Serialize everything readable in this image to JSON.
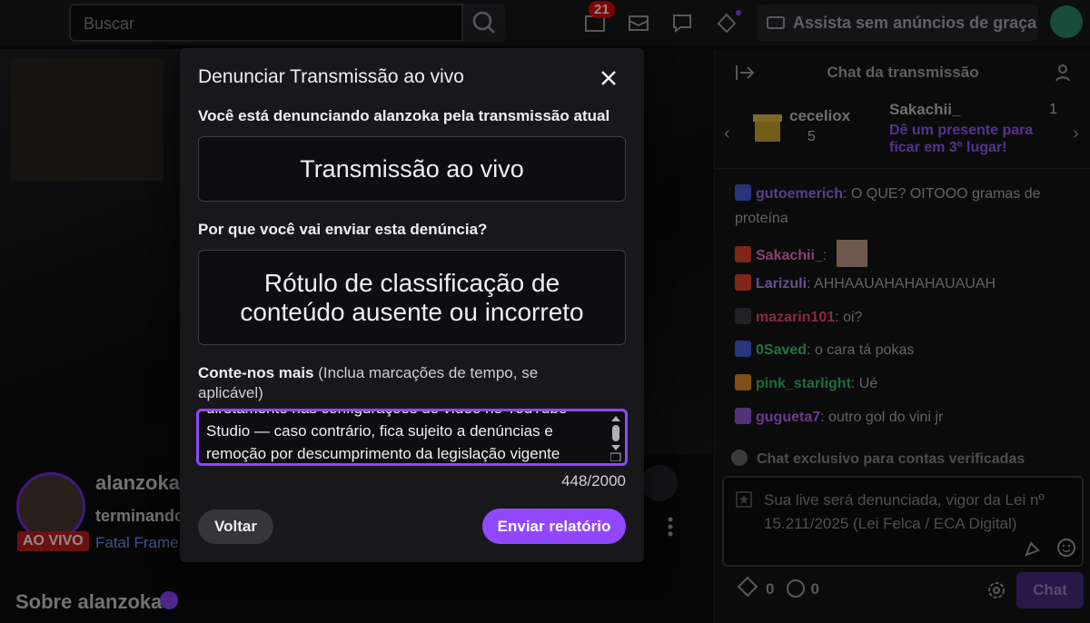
{
  "topbar": {
    "search_placeholder": "Buscar",
    "notification_count": "21",
    "promo_label": "Assista sem anúncios de graça"
  },
  "stream": {
    "streamer": "alanzoka",
    "title": "terminando",
    "game": "Fatal Frame",
    "live_label": "AO VIVO",
    "about": "Sobre alanzoka"
  },
  "chat": {
    "title": "Chat da transmissão",
    "gift_banner": {
      "first_user": "ceceliox",
      "first_count": "5",
      "second_user": "Sakachii_",
      "second_count": "1",
      "cta": "Dê um presente para ficar em 3º lugar!"
    },
    "messages": [
      {
        "user": "gutoemerich",
        "color": "#a970ff",
        "text": ": O QUE? OITOOO gramas de proteína"
      },
      {
        "user": "Sakachii_",
        "color": "#ff6fd8",
        "text": ":"
      },
      {
        "user": "Larizuli",
        "color": "#c48bff",
        "text": ": AHHAAUAHAHAHAUAUAH"
      },
      {
        "user": "mazarin101",
        "color": "#ff4d6d",
        "text": ": oi?"
      },
      {
        "user": "0Saved",
        "color": "#3ecf6e",
        "text": ": o cara tá pokas"
      },
      {
        "user": "pink_starlight",
        "color": "#2fc75f",
        "text": ": Ué"
      },
      {
        "user": "gugueta7",
        "color": "#c06cff",
        "text": ": outro gol do vini jr"
      }
    ],
    "verified_note": "Chat exclusivo para contas verificadas",
    "input_text": "Sua live será denunciada, vigor da Lei nº 15.211/2025 (Lei Felca / ECA Digital)",
    "points_a": "0",
    "points_b": "0",
    "send_label": "Chat"
  },
  "modal": {
    "title": "Denunciar Transmissão ao vivo",
    "reporting_text": "Você está denunciando alanzoka pela transmissão atual",
    "content_type": "Transmissão ao vivo",
    "why_label": "Por que você vai enviar esta denúncia?",
    "reason": "Rótulo de classificação de conteúdo ausente ou incorreto",
    "tell_label_bold": "Conte-nos mais",
    "tell_label_hint": " (Inclua marcações de tempo, se aplicável)",
    "details_text": "diretamente nas configurações do vídeo no YouTube Studio — caso contrário, fica sujeito a denúncias e remoção por descumprimento da legislação vigente",
    "char_count": "448/2000",
    "back_label": "Voltar",
    "submit_label": "Enviar relatório"
  },
  "colors": {
    "accent": "#9147ff",
    "live_red": "#c71e1e"
  }
}
